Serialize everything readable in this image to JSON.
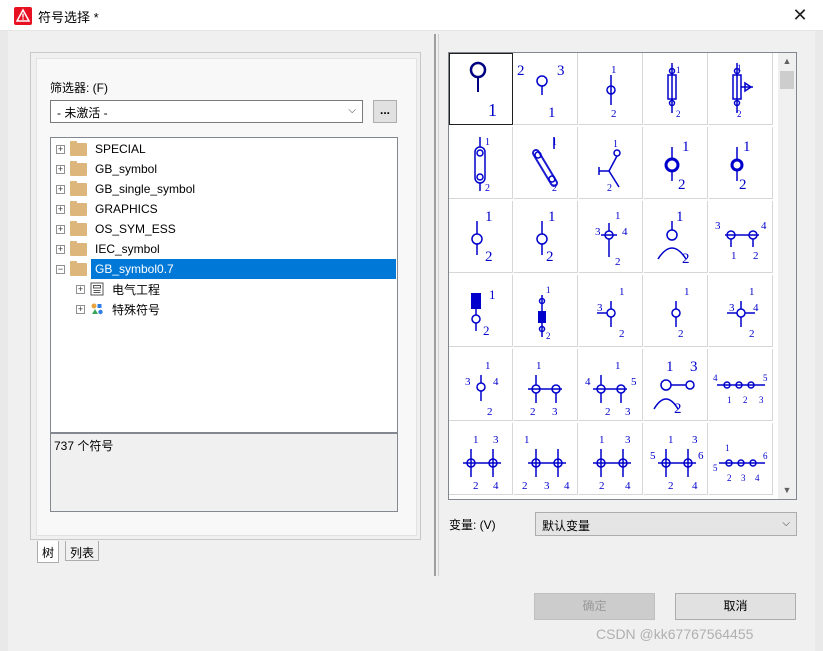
{
  "window": {
    "title": "符号选择 *",
    "close_glyph": "✕",
    "app_icon": "warning-triangle-icon",
    "accent": "#e81123"
  },
  "filter": {
    "label": "筛选器: (F)",
    "value": "- 未激活 -",
    "more_button": "..."
  },
  "tree": {
    "items": [
      {
        "label": "SPECIAL"
      },
      {
        "label": "GB_symbol"
      },
      {
        "label": "GB_single_symbol"
      },
      {
        "label": "GRAPHICS"
      },
      {
        "label": "OS_SYM_ESS"
      },
      {
        "label": "IEC_symbol"
      },
      {
        "label": "GB_symbol0.7"
      }
    ],
    "children": [
      {
        "label": "电气工程"
      },
      {
        "label": "特殊符号"
      }
    ],
    "selected_color": "#0078d7"
  },
  "count": "737 个符号",
  "tabs": {
    "tree": "树",
    "list": "列表"
  },
  "symbols": {
    "color": "#0000cc",
    "cells": [
      {
        "labels": [
          "1"
        ]
      },
      {
        "labels": [
          "2",
          "3",
          "1"
        ]
      },
      {
        "labels": [
          "1",
          "2"
        ]
      },
      {
        "labels": [
          "1",
          "2"
        ]
      },
      {
        "labels": [
          "1",
          "2"
        ]
      },
      {
        "labels": [
          "1",
          "2"
        ]
      },
      {
        "labels": [
          "1",
          "2"
        ]
      },
      {
        "labels": [
          "1",
          "2"
        ]
      },
      {
        "labels": [
          "1",
          "2"
        ]
      },
      {
        "labels": [
          "1",
          "2"
        ]
      },
      {
        "labels": [
          "1",
          "2"
        ]
      },
      {
        "labels": [
          "1",
          "2"
        ]
      },
      {
        "labels": [
          "1",
          "3",
          "4",
          "2"
        ]
      },
      {
        "labels": [
          "1",
          "2"
        ]
      },
      {
        "labels": [
          "3",
          "4",
          "1",
          "2"
        ]
      },
      {
        "labels": [
          "1",
          "2"
        ]
      },
      {
        "labels": [
          "1",
          "2"
        ]
      },
      {
        "labels": [
          "1",
          "3",
          "2"
        ]
      },
      {
        "labels": [
          "1",
          "2"
        ]
      },
      {
        "labels": [
          "1",
          "3",
          "4",
          "2"
        ]
      },
      {
        "labels": [
          "1",
          "3",
          "4",
          "2"
        ]
      },
      {
        "labels": [
          "1",
          "2",
          "3"
        ]
      },
      {
        "labels": [
          "1",
          "4",
          "5",
          "2",
          "3"
        ]
      },
      {
        "labels": [
          "1",
          "3",
          "2"
        ]
      },
      {
        "labels": [
          "4",
          "5",
          "1",
          "2",
          "3"
        ]
      },
      {
        "labels": [
          "1",
          "3",
          "2",
          "4"
        ]
      },
      {
        "labels": [
          "1",
          "2",
          "3",
          "4"
        ]
      },
      {
        "labels": [
          "1",
          "3",
          "2",
          "4"
        ]
      },
      {
        "labels": [
          "1",
          "3",
          "5",
          "6",
          "2",
          "4"
        ]
      },
      {
        "labels": [
          "1",
          "5",
          "6",
          "2",
          "3",
          "4"
        ]
      }
    ]
  },
  "variant": {
    "label": "变量: (V)",
    "value": "默认变量"
  },
  "buttons": {
    "ok": "确定",
    "cancel": "取消"
  },
  "watermark": "CSDN @kk67767564455"
}
